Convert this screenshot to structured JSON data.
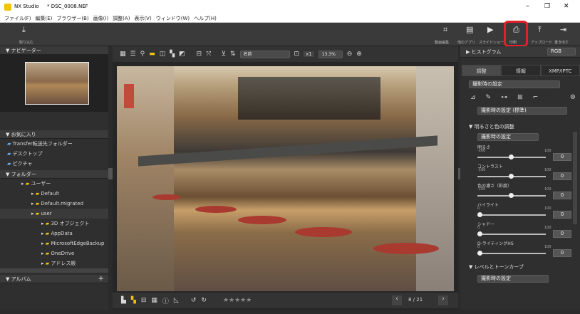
{
  "app": {
    "title": "NX Studio",
    "file": "* DSC_0008.NEF",
    "win_min": "–",
    "win_max": "❐",
    "win_close": "✕"
  },
  "menu": [
    "ファイル(F)",
    "編集(E)",
    "ブラウザー(B)",
    "画像(I)",
    "調整(A)",
    "表示(V)",
    "ウィンドウ(W)",
    "ヘルプ(H)"
  ],
  "toolbar": {
    "import": "取り込む",
    "right": [
      "動画編集",
      "他のアプリ",
      "スライドショー",
      "印刷",
      "アップロード",
      "書き出す"
    ],
    "highlight": "#e0202c"
  },
  "navigator": {
    "title": "ナビゲーター"
  },
  "favorites": {
    "title": "お気に入り",
    "items": [
      "Transfer転送先フォルダー",
      "デスクトップ",
      "ピクチャ"
    ]
  },
  "folders": {
    "title": "フォルダー",
    "items": [
      "ユーザー",
      "Default",
      "Default.migrated",
      "user",
      "3D オブジェクト",
      "AppData",
      "MicrosoftEdgeBackup",
      "OneDrive",
      "アドレス帳"
    ]
  },
  "album": {
    "title": "アルバム",
    "add": "+"
  },
  "viewbar": {
    "sort": "名前",
    "zoom_x1": "x1",
    "zoom_pct": "13.3%"
  },
  "bottombar": {
    "counter": "8 / 21"
  },
  "right": {
    "histogram": "ヒストグラム",
    "channel": "RGB",
    "tabs": [
      "調整",
      "情報",
      "XMP/IPTC"
    ],
    "preset": "撮影時の設定",
    "picture_control": "撮影時の設定 (標準)",
    "section_bright": "明るさと色の調整",
    "section_preset": "撮影時の設定",
    "sliders": [
      {
        "label": "明るさ",
        "min": "-100",
        "max": "100",
        "val": "0"
      },
      {
        "label": "コントラスト",
        "min": "-100",
        "max": "100",
        "val": "0"
      },
      {
        "label": "色の濃さ（彩度）",
        "min": "-100",
        "max": "100",
        "val": "0"
      },
      {
        "label": "ハイライト",
        "min": "0",
        "max": "100",
        "val": "0"
      },
      {
        "label": "シャドー",
        "min": "0",
        "max": "100",
        "val": "0"
      },
      {
        "label": "D-ライティングHS",
        "min": "0",
        "max": "100",
        "val": "0"
      }
    ],
    "section_levels": "レベルとトーンカーブ",
    "levels_preset": "撮影時の設定"
  }
}
